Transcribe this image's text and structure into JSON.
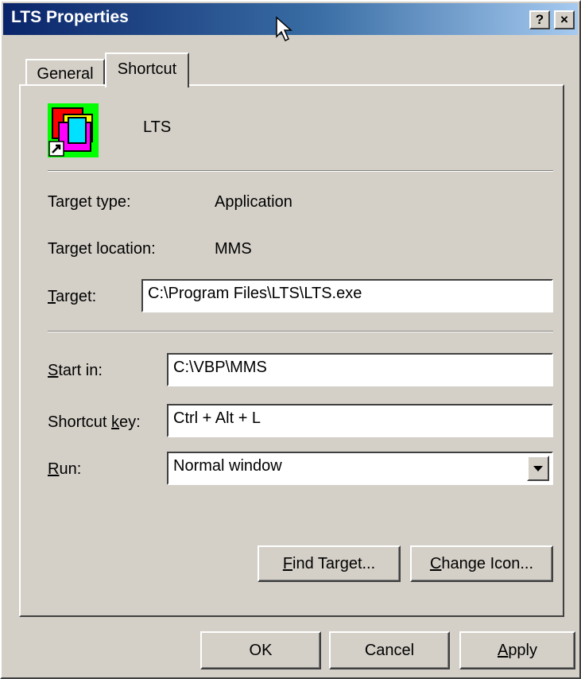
{
  "window": {
    "title": "LTS Properties",
    "help_glyph": "?",
    "close_glyph": "×"
  },
  "tabs": [
    {
      "label": "General"
    },
    {
      "label": "Shortcut"
    }
  ],
  "shortcut": {
    "name": "LTS",
    "target_type_label": "Target type:",
    "target_type_value": "Application",
    "target_location_label": "Target location:",
    "target_location_value": "MMS",
    "target_label_key": "T",
    "target_label_rest": "arget:",
    "target_value": "C:\\Program Files\\LTS\\LTS.exe",
    "start_in_label_key": "S",
    "start_in_label_rest": "tart in:",
    "start_in_value": "C:\\VBP\\MMS",
    "shortcut_key_label_pre": "Shortcut ",
    "shortcut_key_label_key": "k",
    "shortcut_key_label_rest": "ey:",
    "shortcut_key_value": "Ctrl + Alt + L",
    "run_label_key": "R",
    "run_label_rest": "un:",
    "run_value": "Normal window",
    "find_target_key": "F",
    "find_target_rest": "ind Target...",
    "change_icon_key": "C",
    "change_icon_rest": "hange Icon..."
  },
  "footer": {
    "ok": "OK",
    "cancel": "Cancel",
    "apply_key": "A",
    "apply_rest": "pply"
  },
  "colors": {
    "titlebar_start": "#0a246a",
    "titlebar_end": "#a6caf0",
    "face": "#d4d0c8"
  }
}
